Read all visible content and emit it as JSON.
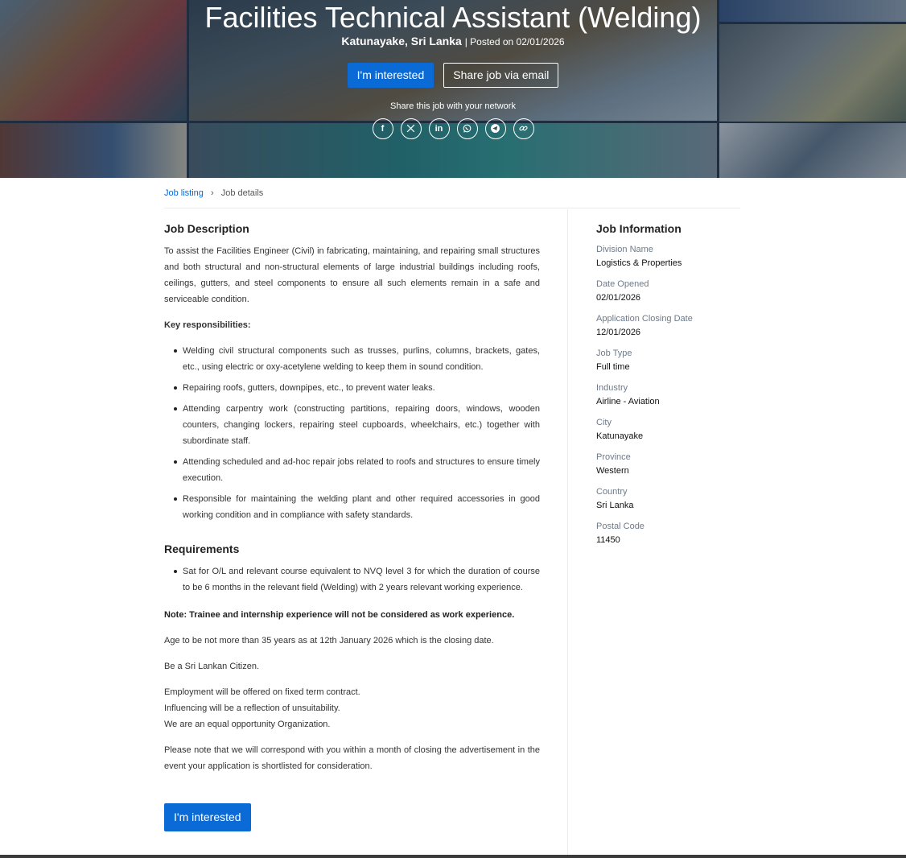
{
  "hero": {
    "title": "Facilities Technical Assistant (Welding)",
    "location": "Katunayake, Sri Lanka",
    "posted": "| Posted on 02/01/2026",
    "interested_label": "I'm interested",
    "share_email_label": "Share job via email",
    "share_label": "Share this job with your network",
    "share_icons": [
      "facebook-icon",
      "x-icon",
      "linkedin-icon",
      "whatsapp-icon",
      "telegram-icon",
      "link-icon"
    ]
  },
  "breadcrumb": {
    "link": "Job listing",
    "current": "Job details"
  },
  "description": {
    "heading": "Job Description",
    "summary": "To assist the Facilities Engineer (Civil) in fabricating, maintaining, and repairing small structures and both structural and non-structural elements of large industrial buildings including roofs, ceilings, gutters, and steel components to ensure all such elements remain in a safe and serviceable condition.",
    "key_label": "Key responsibilities:",
    "responsibilities": [
      "Welding civil structural components such as trusses, purlins, columns, brackets, gates, etc., using electric or oxy-acetylene welding to keep them in sound condition.",
      "Repairing roofs, gutters, downpipes, etc., to prevent water leaks.",
      "Attending carpentry work (constructing partitions, repairing doors, windows, wooden counters, changing lockers, repairing steel cupboards, wheelchairs, etc.) together with subordinate staff.",
      "Attending scheduled and ad-hoc repair jobs related to roofs and structures to ensure timely execution.",
      "Responsible for maintaining the welding plant and other required accessories in good working condition and in compliance with safety standards."
    ]
  },
  "requirements": {
    "heading": "Requirements",
    "items": [
      "Sat for O/L and relevant course equivalent to NVQ level 3 for which the duration of course to be 6 months in the relevant field (Welding) with 2 years relevant working experience."
    ],
    "note": "Note: Trainee and internship experience will not be considered as work experience.",
    "age": "Age to be not more than 35 years as at 12th January 2026 which is the closing date.",
    "citizen": "Be a Sri Lankan Citizen.",
    "employment_lines": [
      "Employment will be offered on fixed term contract.",
      "Influencing will be a reflection of unsuitability.",
      "We are an equal opportunity Organization."
    ],
    "correspond": "Please note that we will correspond with you within a month of closing the advertisement in the event your application is shortlisted for consideration.",
    "interested_label": "I'm interested"
  },
  "job_info": {
    "heading": "Job Information",
    "items": [
      {
        "label": "Division Name",
        "value": "Logistics & Properties"
      },
      {
        "label": "Date Opened",
        "value": "02/01/2026"
      },
      {
        "label": "Application Closing Date",
        "value": "12/01/2026"
      },
      {
        "label": "Job Type",
        "value": "Full time"
      },
      {
        "label": "Industry",
        "value": "Airline - Aviation"
      },
      {
        "label": "City",
        "value": "Katunayake"
      },
      {
        "label": "Province",
        "value": "Western"
      },
      {
        "label": "Country",
        "value": "Sri Lanka"
      },
      {
        "label": "Postal Code",
        "value": "11450"
      }
    ]
  },
  "colors": {
    "accent": "#0a6ad6",
    "label_gray": "#6d7a8a"
  }
}
